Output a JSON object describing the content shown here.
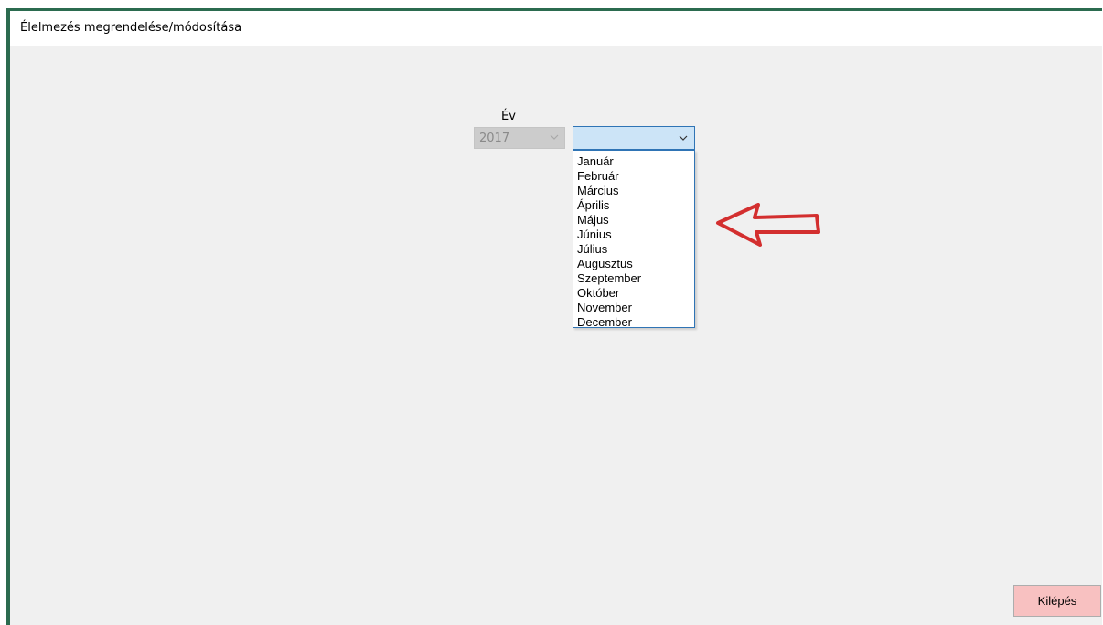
{
  "window": {
    "title": "Élelmezés megrendelése/módosítása",
    "frame_color": "#2b6b4f"
  },
  "year": {
    "label": "Év",
    "value": "2017",
    "enabled": false
  },
  "month": {
    "value": "",
    "options": [
      "Január",
      "Február",
      "Március",
      "Április",
      "Május",
      "Június",
      "Július",
      "Augusztus",
      "Szeptember",
      "Október",
      "November",
      "December"
    ],
    "dropdown_open": true
  },
  "annotation": {
    "icon": "left-arrow-icon",
    "color": "#d32f2f"
  },
  "footer": {
    "exit_label": "Kilépés",
    "exit_color": "#f8c1c1"
  }
}
